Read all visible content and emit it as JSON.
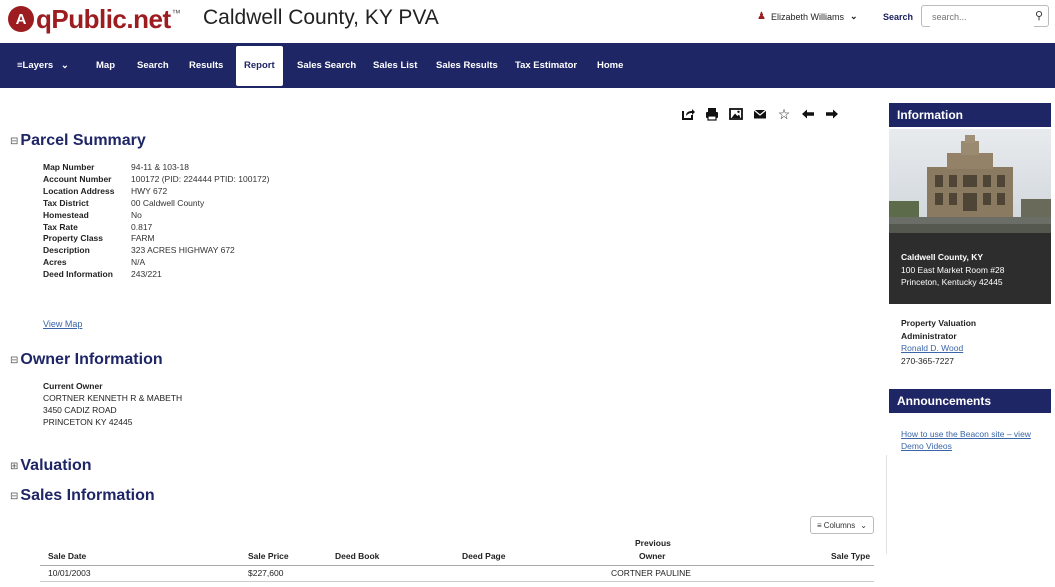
{
  "header": {
    "logo_badge": "A",
    "logo_text": "qPublic.net",
    "logo_tm": "™",
    "site_title": "Caldwell County, KY PVA",
    "user_name": "Elizabeth Williams",
    "search_label": "Search",
    "search_placeholder": "search..."
  },
  "nav": {
    "items": [
      {
        "label": "Layers"
      },
      {
        "label": "Map"
      },
      {
        "label": "Search"
      },
      {
        "label": "Results"
      },
      {
        "label": "Report"
      },
      {
        "label": "Sales Search"
      },
      {
        "label": "Sales List"
      },
      {
        "label": "Sales Results"
      },
      {
        "label": "Tax Estimator"
      },
      {
        "label": "Home"
      }
    ],
    "active": "Report"
  },
  "toolbar": {
    "icons": [
      "share-icon",
      "print-icon",
      "image-icon",
      "email-icon",
      "star-icon",
      "arrow-left-icon",
      "arrow-right-icon"
    ]
  },
  "parcel": {
    "heading": "Parcel Summary",
    "rows": [
      {
        "label": "Map Number",
        "value": "94-11 & 103-18"
      },
      {
        "label": "Account Number",
        "value": "100172 (PID: 224444 PTID: 100172)"
      },
      {
        "label": "Location Address",
        "value": "HWY 672"
      },
      {
        "label": "Tax District",
        "value": "00 Caldwell County"
      },
      {
        "label": "Homestead",
        "value": "No"
      },
      {
        "label": "Tax Rate",
        "value": "0.817"
      },
      {
        "label": "Property Class",
        "value": "FARM"
      },
      {
        "label": "Description",
        "value": "323 ACRES HIGHWAY 672"
      },
      {
        "label": "Acres",
        "value": "N/A"
      },
      {
        "label": "Deed Information",
        "value": "243/221"
      }
    ],
    "view_map": "View Map"
  },
  "owner": {
    "heading": "Owner Information",
    "label": "Current Owner",
    "lines": [
      "CORTNER KENNETH R & MABETH",
      "3450 CADIZ ROAD",
      "PRINCETON KY 42445"
    ]
  },
  "valuation": {
    "heading": "Valuation"
  },
  "sales": {
    "heading": "Sales Information",
    "columns_button": "Columns",
    "headers": [
      "Sale Date",
      "Sale Price",
      "Deed Book",
      "Deed Page",
      "Previous",
      "Owner",
      "Sale Type"
    ],
    "rows": [
      {
        "date": "10/01/2003",
        "price": "$227,600",
        "book": "",
        "page": "",
        "prev_owner": "CORTNER PAULINE",
        "type": ""
      }
    ]
  },
  "sidebar": {
    "info_heading": "Information",
    "county": "Caldwell County, KY",
    "addr1": "100 East Market Room #28",
    "addr2": "Princeton, Kentucky 42445",
    "pva_title1": "Property Valuation",
    "pva_title2": "Administrator",
    "pva_name": "Ronald D. Wood",
    "pva_phone": "270-365-7227",
    "announce_heading": "Announcements",
    "announce_link": "How to use the Beacon site – view Demo Videos"
  },
  "colors": {
    "brand_red": "#9c1c20",
    "nav_blue": "#1f2666",
    "link_blue": "#3a66a8"
  }
}
